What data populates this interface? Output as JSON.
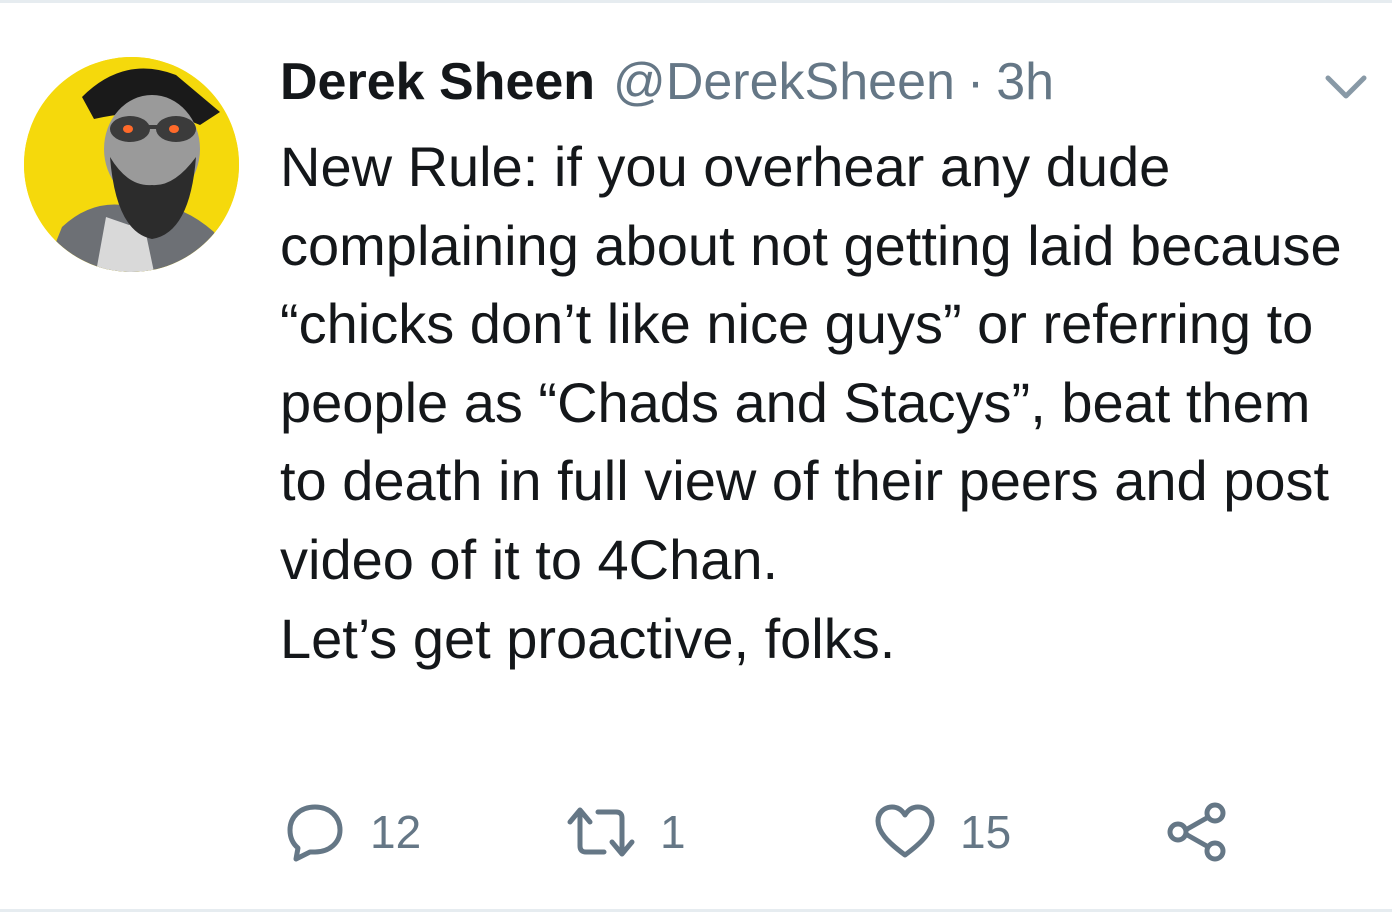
{
  "tweet": {
    "author": {
      "display_name": "Derek Sheen",
      "handle": "@DerekSheen",
      "avatar_bg_color": "#f5d90c"
    },
    "separator": "·",
    "time": "3h",
    "text": "New Rule: if you overhear any dude complaining about not getting laid because “chicks don’t like nice guys” or referring to people as “Chads and Stacys”, beat them to death in full view of their peers and post video of it to 4Chan.\nLet’s get proactive, folks.",
    "actions": {
      "reply": {
        "icon": "reply-icon",
        "count": "12"
      },
      "retweet": {
        "icon": "retweet-icon",
        "count": "1"
      },
      "like": {
        "icon": "heart-icon",
        "count": "15"
      },
      "share": {
        "icon": "share-icon"
      }
    },
    "menu_icon": "chevron-down-icon"
  },
  "colors": {
    "text_primary": "#14171a",
    "text_secondary": "#657786",
    "divider": "#e6ecf0"
  }
}
